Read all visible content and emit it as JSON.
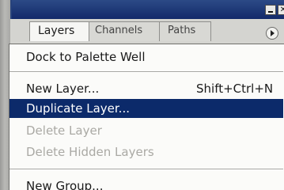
{
  "panel": {
    "tabs": [
      {
        "label": "Layers"
      },
      {
        "label": "Channels"
      },
      {
        "label": "Paths"
      }
    ],
    "close_glyph": "✕"
  },
  "menu": {
    "dock_label": "Dock to Palette Well",
    "new_layer_label": "New Layer...",
    "new_layer_shortcut": "Shift+Ctrl+N",
    "duplicate_layer_label": "Duplicate Layer...",
    "delete_layer_label": "Delete Layer",
    "delete_hidden_label": "Delete Hidden Layers",
    "new_group_label": "New Group..."
  },
  "colors": {
    "titlebar": "#12296a",
    "selection": "#0c2a6a",
    "disabled_text": "#aaa9a4"
  }
}
